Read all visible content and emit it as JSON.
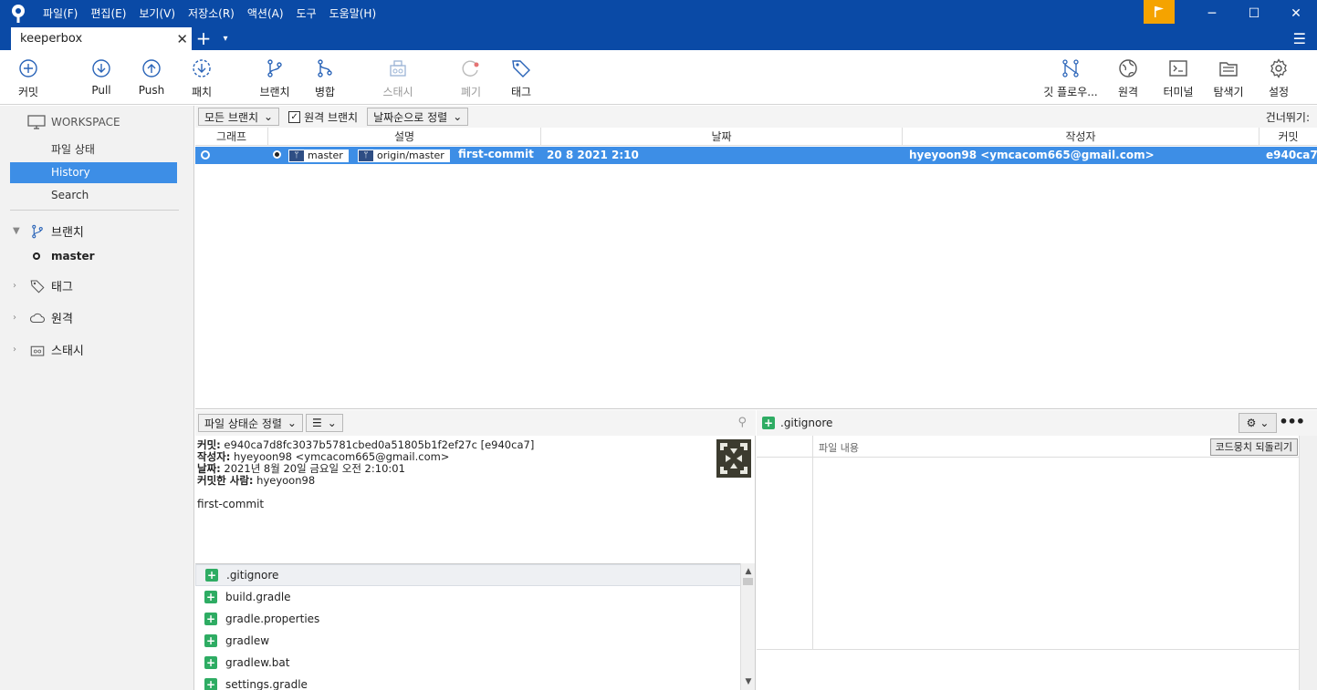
{
  "menu": [
    "파일(F)",
    "편집(E)",
    "보기(V)",
    "저장소(R)",
    "액션(A)",
    "도구",
    "도움말(H)"
  ],
  "window": {
    "minimize": "─",
    "maximize": "☐",
    "close": "✕"
  },
  "tab": {
    "name": "keeperbox",
    "close": "✕",
    "add": "+",
    "dropdown": "▾",
    "menu": "☰"
  },
  "toolbar": {
    "commit": "커밋",
    "pull": "Pull",
    "push": "Push",
    "fetch": "패치",
    "branch": "브랜치",
    "merge": "병합",
    "stash": "스태시",
    "discard": "폐기",
    "tag": "태그",
    "gitflow": "깃 플로우...",
    "remote": "원격",
    "terminal": "터미널",
    "explorer": "탐색기",
    "settings": "설정"
  },
  "sidebar": {
    "workspace": "WORKSPACE",
    "file_status": "파일 상태",
    "history": "History",
    "search": "Search",
    "branches": "브랜치",
    "branch_master": "master",
    "tags": "태그",
    "remotes": "원격",
    "stashes": "스태시"
  },
  "filters": {
    "all_branches": "모든 브랜치",
    "remote_branches": "원격 브랜치",
    "sort_by_date": "날짜순으로 정렬",
    "jump_to": "건너뛰기:"
  },
  "columns": {
    "graph": "그래프",
    "description": "설명",
    "date": "날짜",
    "author": "작성자",
    "commit": "커밋"
  },
  "commit_row": {
    "ref_local": "master",
    "ref_remote": "origin/master",
    "message": "first-commit",
    "date": "20 8 2021 2:10",
    "author": "hyeyoon98 <ymcacom665@gmail.com>",
    "hash": "e940ca7"
  },
  "details": {
    "sort": "파일 상태순 정렬",
    "list_icon": "☰",
    "commit_label": "커밋:",
    "commit_value": "e940ca7d8fc3037b5781cbed0a51805b1f2ef27c [e940ca7]",
    "author_label": "작성자:",
    "author_value": "hyeyoon98 <ymcacom665@gmail.com>",
    "date_label": "날짜:",
    "date_value": "2021년 8월 20일 금요일 오전 2:10:01",
    "committer_label": "커밋한 사람:",
    "committer_value": "hyeyoon98",
    "message": "first-commit"
  },
  "files": [
    ".gitignore",
    "build.gradle",
    "gradle.properties",
    "gradlew",
    "gradlew.bat",
    "settings.gradle"
  ],
  "diff": {
    "file": ".gitignore",
    "content_label": "파일 내용",
    "revert_hunk": "코드뭉치 되돌리기",
    "more": "•••"
  }
}
